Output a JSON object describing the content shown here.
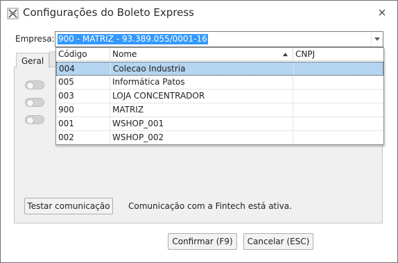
{
  "window": {
    "title": "Configurações do Boleto Express"
  },
  "empresa": {
    "label": "Empresa:",
    "value": "900 - MATRIZ - 93.389.055/0001-16"
  },
  "tabs": [
    {
      "label": "Geral"
    }
  ],
  "dropdown": {
    "columns": [
      "Código",
      "Nome",
      "CNPJ"
    ],
    "sort_column": "Nome",
    "sort_direction": "ascending",
    "rows": [
      {
        "codigo": "004",
        "nome": "Colecao Industria",
        "cnpj": "",
        "selected": true
      },
      {
        "codigo": "005",
        "nome": "Informática Patos",
        "cnpj": ""
      },
      {
        "codigo": "003",
        "nome": "LOJA CONCENTRADOR",
        "cnpj": ""
      },
      {
        "codigo": "900",
        "nome": "MATRIZ",
        "cnpj": ""
      },
      {
        "codigo": "001",
        "nome": "WSHOP_001",
        "cnpj": ""
      },
      {
        "codigo": "002",
        "nome": "WSHOP_002",
        "cnpj": ""
      }
    ]
  },
  "toggles": [
    {
      "state": "off"
    },
    {
      "state": "off"
    },
    {
      "state": "off"
    }
  ],
  "connection": {
    "test_button": "Testar comunicação",
    "status": "Comunicação com a Fintech está ativa."
  },
  "footer": {
    "confirm_button": "Confirmar (F9)",
    "cancel_button": "Cancelar (ESC)"
  },
  "colors": {
    "selection_highlight": "#3399ff",
    "selected_row": "#b4d4f0",
    "panel_background": "#f0f0f0"
  },
  "icons": {
    "app": "boleto-express-icon",
    "close": "close-icon",
    "combo_arrow": "chevron-down-icon",
    "sort": "sort-ascending-icon"
  }
}
